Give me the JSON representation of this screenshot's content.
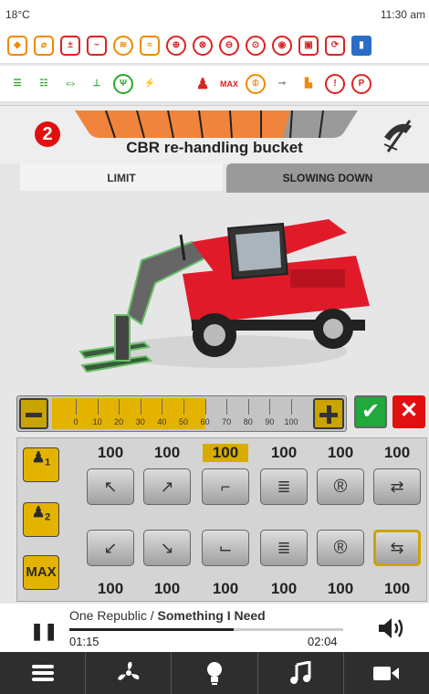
{
  "status": {
    "temperature": "18°C",
    "time": "11:30 am"
  },
  "warning_icons_row1": [
    "engine-warning-icon",
    "coolant-temp-icon",
    "battery-icon",
    "oil-pressure-icon",
    "preheat-icon",
    "fuel-level-icon",
    "transmission-icon",
    "filter-icon",
    "hydraulic-icon",
    "ack-icon",
    "brake-icon",
    "seat-icon",
    "service-icon",
    "info-icon"
  ],
  "warning_icons_row2": [
    "low-beam-icon",
    "high-beam-icon",
    "turn-signal-icon",
    "outrigger-icon",
    "radio-icon",
    "boom-icon",
    "operator-icon",
    "max-load-icon",
    "parking-brake-icon",
    "hook-icon",
    "fuel-icon",
    "brake-warning-icon",
    "park-icon"
  ],
  "header": {
    "badge": "2",
    "tool_name": "CBR re-handling bucket"
  },
  "tabs": {
    "limit": "LIMIT",
    "slowing_down": "SLOWING DOWN"
  },
  "slider": {
    "ticks": [
      "0",
      "10",
      "20",
      "30",
      "40",
      "50",
      "60",
      "70",
      "80",
      "90",
      "100"
    ],
    "value": 60
  },
  "panel": {
    "operator_buttons": {
      "op1": "1",
      "op2": "2",
      "max": "MAX"
    },
    "top_values": [
      "100",
      "100",
      "100",
      "100",
      "100",
      "100"
    ],
    "bottom_values": [
      "100",
      "100",
      "100",
      "100",
      "100",
      "100"
    ],
    "highlighted_top_index": 2
  },
  "media": {
    "artist": "One Republic / ",
    "title": "Something I Need",
    "elapsed": "01:15",
    "duration": "02:04",
    "progress": 0.6
  },
  "colors": {
    "accent": "#e4b300",
    "danger": "#e01010",
    "ok": "#22a83c",
    "segment": "#f0843c"
  }
}
